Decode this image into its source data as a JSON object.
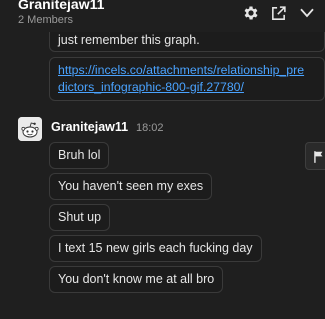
{
  "header": {
    "title": "Granitejaw11",
    "subtitle": "2 Members",
    "icons": [
      "gear-icon",
      "popout-icon",
      "chevron-down-icon"
    ]
  },
  "messages_prev": {
    "text": "just remember this graph.",
    "link": "https://incels.co/attachments/relationship_predictors_infographic-800-gif.27780/",
    "link_line1": "https://incels.co/attachments/relationship_pre",
    "link_line2": "dictors_infographic-800-gif.27780/"
  },
  "group": {
    "author": "Granitejaw11",
    "time": "18:02",
    "avatar_icon": "reddit-snoo-icon",
    "messages": [
      "Bruh lol",
      "You haven't seen my exes",
      "Shut up",
      "I text 15 new girls each fucking day",
      "You don't know me at all bro"
    ]
  },
  "colors": {
    "background": "#1f1f1f",
    "bubble_border": "#3a3a3a",
    "link": "#4aa3ff"
  }
}
